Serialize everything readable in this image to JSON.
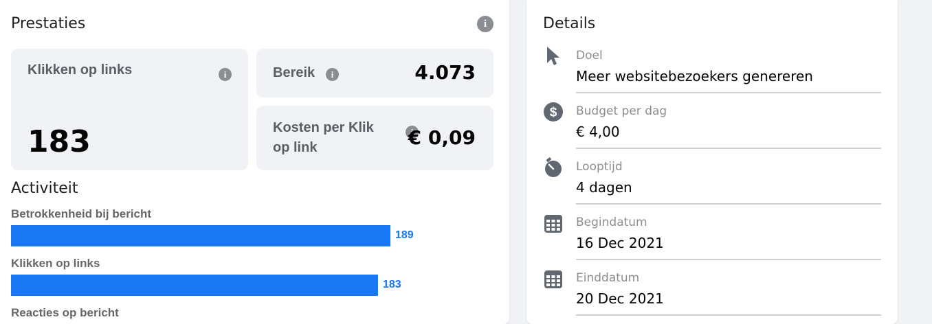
{
  "performance": {
    "title": "Prestaties",
    "link_clicks": {
      "label": "Klikken op links",
      "value": "183"
    },
    "reach": {
      "label": "Bereik",
      "value": "4.073"
    },
    "cpc": {
      "label_line1": "Kosten per Klik",
      "label_line2": "op link",
      "value": "€ 0,09"
    }
  },
  "activity": {
    "title": "Activiteit",
    "items": [
      {
        "label": "Betrokkenheid bij bericht",
        "value": 189
      },
      {
        "label": "Klikken op links",
        "value": 183
      },
      {
        "label": "Reacties op bericht",
        "value": null
      }
    ]
  },
  "details": {
    "title": "Details",
    "items": [
      {
        "icon": "cursor-icon",
        "label": "Doel",
        "value": "Meer websitebezoekers genereren"
      },
      {
        "icon": "dollar-icon",
        "label": "Budget per dag",
        "value": "€ 4,00"
      },
      {
        "icon": "stopwatch-icon",
        "label": "Looptijd",
        "value": "4 dagen"
      },
      {
        "icon": "calendar-icon",
        "label": "Begindatum",
        "value": "16 Dec 2021"
      },
      {
        "icon": "calendar-icon",
        "label": "Einddatum",
        "value": "20 Dec 2021"
      }
    ]
  },
  "colors": {
    "accent": "#1877f2",
    "card_bg": "#f0f2f5",
    "icon_gray": "#606770"
  }
}
